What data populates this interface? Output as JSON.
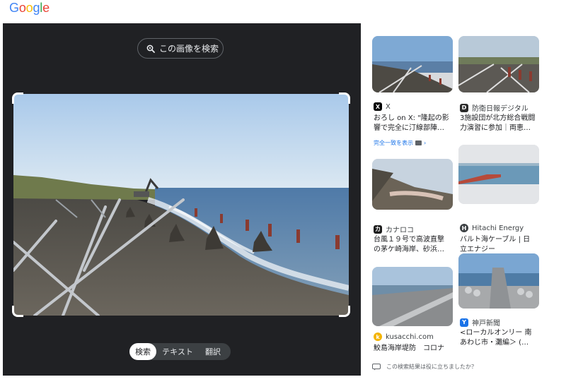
{
  "app": {
    "logo_text": "Google",
    "logo_colors": [
      "#4285F4",
      "#EA4335",
      "#FBBC05",
      "#4285F4",
      "#34A853",
      "#EA4335"
    ]
  },
  "lens": {
    "search_image_label": "この画像を検索",
    "modes": [
      "検索",
      "テキスト",
      "翻訳"
    ],
    "active_mode": "検索"
  },
  "results": [
    {
      "source": "X",
      "favicon": "x-icon",
      "title": "おろし on X: \"隆起の影",
      "title2": "響で完全に汀線部陣…",
      "exact_match": "完全一致を表示"
    },
    {
      "source": "防衛日報デジタル",
      "favicon": "bouei-icon",
      "title": "3施設団が北方総合戦闘",
      "title2": "力演習に参加｜両恵…"
    },
    {
      "source": "カナロコ",
      "favicon": "kanaloco-icon",
      "title": "台風１９号で高波直撃",
      "title2": "の茅ケ崎海岸、砂浜…"
    },
    {
      "source": "Hitachi Energy",
      "favicon": "hitachi-icon",
      "title": "バルト海ケーブル | 日",
      "title2": "立エナジー"
    },
    {
      "source": "kusacchi.com",
      "favicon": "kusacchi-icon",
      "title": "鮫島海岸堤防　コロナ",
      "title2": ""
    },
    {
      "source": "神戸新聞",
      "favicon": "kobe-icon",
      "title": "<ローカルオンリー 南",
      "title2": "あわじ市・灘編＞ (…"
    }
  ],
  "feedback": {
    "prompt": "この検索結果は役に立ちましたか？"
  },
  "colors": {
    "panel_dark": "#202124",
    "link_blue": "#1a73e8"
  }
}
